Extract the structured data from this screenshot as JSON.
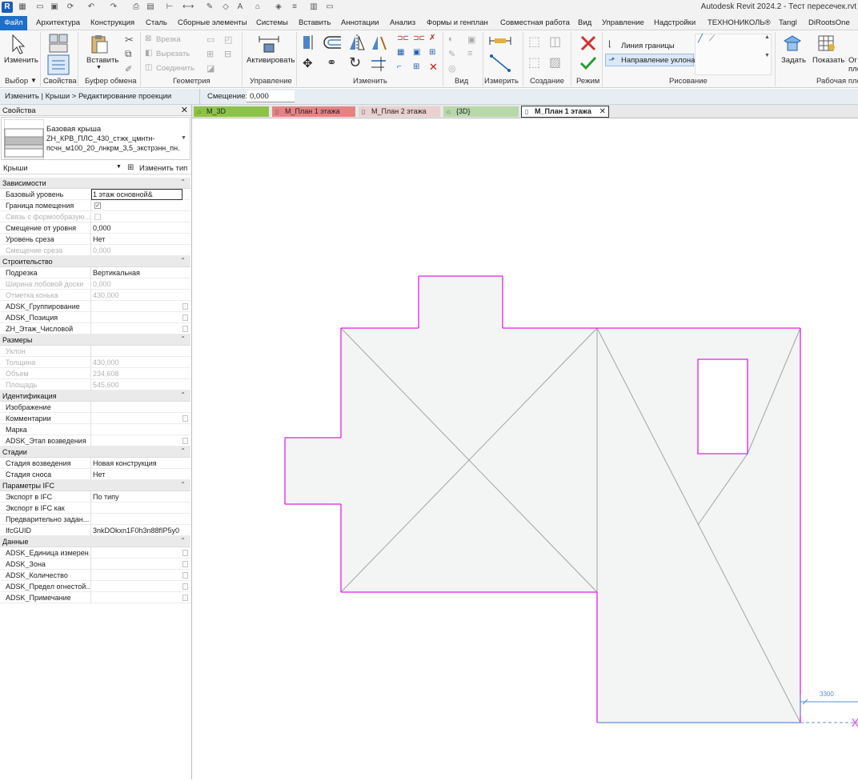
{
  "window": {
    "title": "Autodesk Revit 2024.2 - Тест пересечек.rvt"
  },
  "menu": {
    "tabs": [
      "Файл",
      "Архитектура",
      "Конструкция",
      "Сталь",
      "Сборные элементы",
      "Системы",
      "Вставить",
      "Аннотации",
      "Анализ",
      "Формы и генплан",
      "Совместная работа",
      "Вид",
      "Управление",
      "Надстройки",
      "ТЕХНОНИКОЛЬ®",
      "Tangl",
      "DiRootsOne"
    ]
  },
  "ribbon": {
    "modify_label": "Изменить",
    "insert_label": "Вставить",
    "activate_label": "Активировать",
    "cut_label": "Врезка",
    "cut2_label": "Вырезать",
    "join_label": "Соединить",
    "boundary_line_label": "Линия границы",
    "slope_arrow_label": "Направление уклона",
    "set_label": "Задать",
    "show_label": "Показать",
    "partial_label": "Ог\nпло",
    "panels": {
      "select": "Выбор",
      "properties": "Свойства",
      "clipboard": "Буфер обмена",
      "geometry": "Геометрия",
      "control": "Управление",
      "modify": "Изменить",
      "view": "Вид",
      "measure": "Измерить",
      "create": "Создание",
      "mode": "Режим",
      "draw": "Рисование",
      "workplane": "Рабочая пло"
    }
  },
  "context_bar": {
    "breadcrumb": "Изменить | Крыши > Редактирование проекции",
    "offset_label": "Смещение:",
    "offset_value": "0,000"
  },
  "properties": {
    "title": "Свойства",
    "type_name_line1": "Базовая крыша",
    "type_name_line2": "ZH_КРВ_ПЛС_430_стжк_цмнтн-",
    "type_name_line3": "псчн_м100_20_лнкрм_3,5_экстрзнн_пн...",
    "category": "Крыши",
    "edit_type_label": "Изменить тип",
    "groups": [
      {
        "name": "Зависимости",
        "rows": [
          {
            "name": "Базовый уровень",
            "value": "1 этаж основной&",
            "editing": true
          },
          {
            "name": "Граница помещения",
            "check": true
          },
          {
            "name": "Связь с формообразую...",
            "check": false,
            "dim": true
          },
          {
            "name": "Смещение от уровня",
            "value": "0,000"
          },
          {
            "name": "Уровень среза",
            "value": "Нет"
          },
          {
            "name": "Смещение среза",
            "value": "0,000",
            "dim": true
          }
        ]
      },
      {
        "name": "Строительство",
        "rows": [
          {
            "name": "Подрезка",
            "value": "Вертикальная"
          },
          {
            "name": "Ширина лобовой доски",
            "value": "0,000",
            "dim": true
          },
          {
            "name": "Отметка конька",
            "value": "430,000",
            "dim": true
          },
          {
            "name": "ADSK_Группирование",
            "value": "",
            "btn": true
          },
          {
            "name": "ADSK_Позиция",
            "value": "",
            "btn": true
          },
          {
            "name": "ZH_Этаж_Числовой",
            "value": "",
            "btn": true
          }
        ]
      },
      {
        "name": "Размеры",
        "rows": [
          {
            "name": "Уклон",
            "value": "",
            "dim": true
          },
          {
            "name": "Толщина",
            "value": "430,000",
            "dim": true
          },
          {
            "name": "Объем",
            "value": "234,608",
            "dim": true
          },
          {
            "name": "Площадь",
            "value": "545,600",
            "dim": true
          }
        ]
      },
      {
        "name": "Идентификация",
        "rows": [
          {
            "name": "Изображение",
            "value": ""
          },
          {
            "name": "Комментарии",
            "value": "",
            "btn": true
          },
          {
            "name": "Марка",
            "value": ""
          },
          {
            "name": "ADSK_Этап возведения",
            "value": "",
            "btn": true
          }
        ]
      },
      {
        "name": "Стадии",
        "rows": [
          {
            "name": "Стадия возведения",
            "value": "Новая конструкция"
          },
          {
            "name": "Стадия сноса",
            "value": "Нет"
          }
        ]
      },
      {
        "name": "Параметры IFC",
        "rows": [
          {
            "name": "Экспорт в IFC",
            "value": "По типу"
          },
          {
            "name": "Экспорт в IFC как",
            "value": ""
          },
          {
            "name": "Предварительно задан...",
            "value": ""
          },
          {
            "name": "IfcGUID",
            "value": "3nkDOkxn1F0h3n88fIP5y0"
          }
        ]
      },
      {
        "name": "Данные",
        "rows": [
          {
            "name": "ADSK_Единица измерен...",
            "value": "",
            "btn": true
          },
          {
            "name": "ADSK_Зона",
            "value": "",
            "btn": true
          },
          {
            "name": "ADSK_Количество",
            "value": "",
            "btn": true
          },
          {
            "name": "ADSK_Предел огнестой...",
            "value": "",
            "btn": true
          },
          {
            "name": "ADSK_Примечание",
            "value": "",
            "btn": true
          }
        ]
      }
    ]
  },
  "view_tabs": [
    {
      "label": "М_3D",
      "color": "#8bc34a"
    },
    {
      "label": "М_План 1 этажа",
      "color": "#e57373"
    },
    {
      "label": "М_План 2 этажа",
      "color": "#e8c8c8"
    },
    {
      "label": "{3D}",
      "color": "#b6d7a8"
    },
    {
      "label": "М_План 1 этажа",
      "color": "#ffffff",
      "active": true
    }
  ],
  "canvas": {
    "dimension_value": "3300",
    "colors": {
      "boundary": "#e61ee6",
      "fill": "#f3f4f4",
      "lines": "#a3a3a3",
      "dimension": "#5b8fd9"
    }
  }
}
